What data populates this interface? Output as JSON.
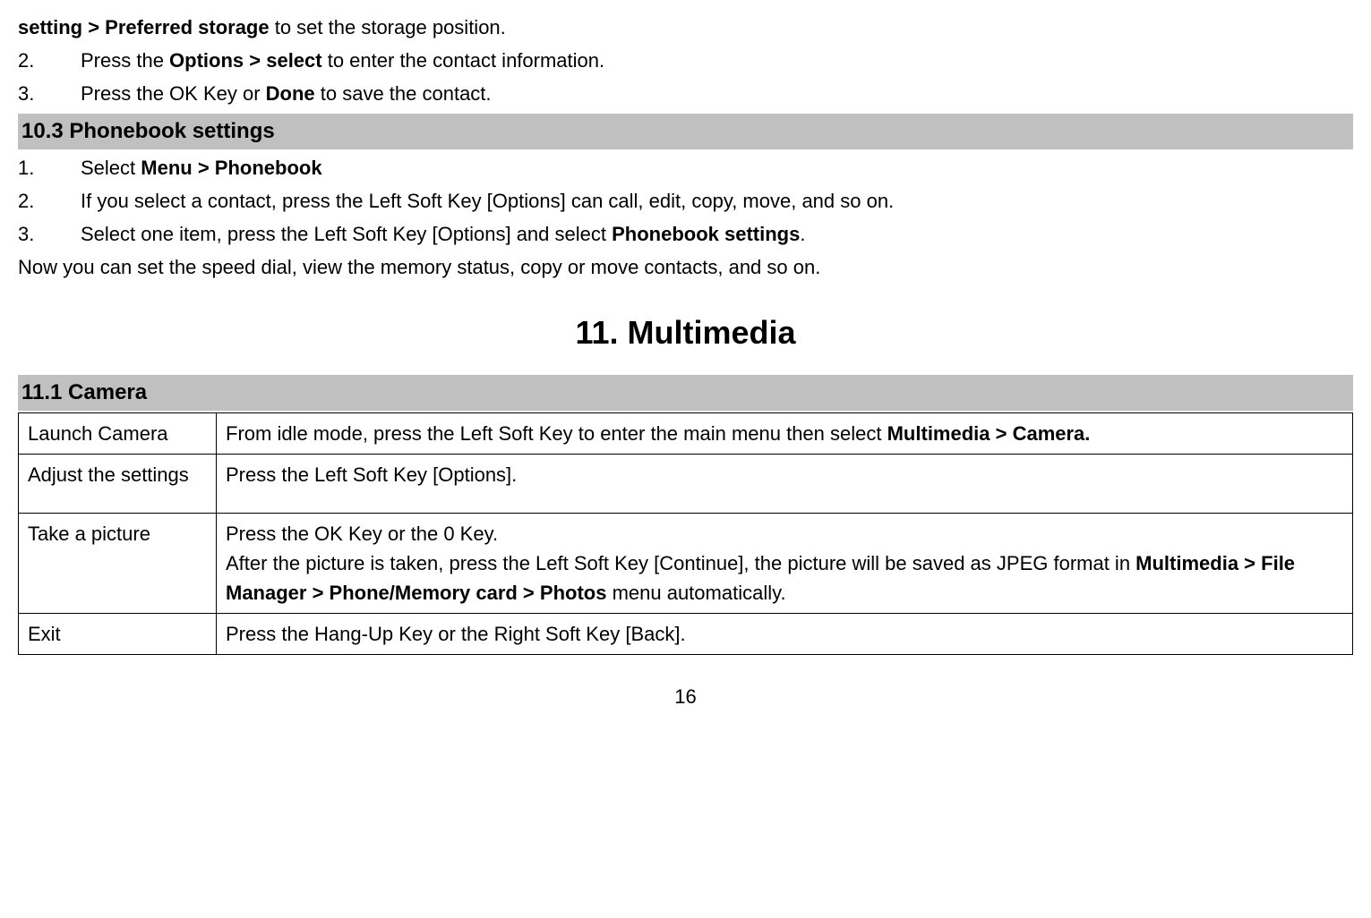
{
  "topline": {
    "bold": "setting > Preferred storage",
    "rest": " to set the storage position."
  },
  "items_a": [
    {
      "num": "2.",
      "pre": "Press the ",
      "bold": "Options > select",
      "post": " to enter the contact information."
    },
    {
      "num": "3.",
      "pre": "Press the OK Key or ",
      "bold": "Done",
      "post": " to save the contact."
    }
  ],
  "section_103": "10.3 Phonebook settings",
  "items_b": [
    {
      "num": "1.",
      "pre": "Select ",
      "bold": "Menu > Phonebook",
      "post": ""
    },
    {
      "num": "2.",
      "pre": "If you select a contact, press the Left Soft Key [Options] can call, edit, copy, move, and so on.",
      "bold": "",
      "post": ""
    },
    {
      "num": "3.",
      "pre": "Select one item, press the Left Soft Key [Options] and select ",
      "bold": "Phonebook settings",
      "post": "."
    }
  ],
  "after_b": "Now you can set the speed dial, view the memory status, copy or move contacts, and so on.",
  "chapter": "11.  Multimedia",
  "section_111": "11.1 Camera",
  "table": {
    "r1_c1": "Launch Camera",
    "r1_c2_pre": "From idle mode, press the Left Soft Key to enter the main menu then select ",
    "r1_c2_bold": "Multimedia > Camera.",
    "r2_c1": "Adjust the settings",
    "r2_c2": "Press the Left Soft Key [Options].",
    "r3_c1": "Take a picture",
    "r3_c2_l1": "Press the OK Key or the 0 Key.",
    "r3_c2_l2_pre": "After the picture is taken, press the Left Soft Key [Continue], the picture will be saved as JPEG format in ",
    "r3_c2_l2_bold": "Multimedia > File Manager > Phone/Memory card > Photos",
    "r3_c2_l2_post": " menu automatically.",
    "r4_c1": "Exit",
    "r4_c2": "Press the Hang-Up Key or the Right Soft Key [Back]."
  },
  "page_number": "16"
}
